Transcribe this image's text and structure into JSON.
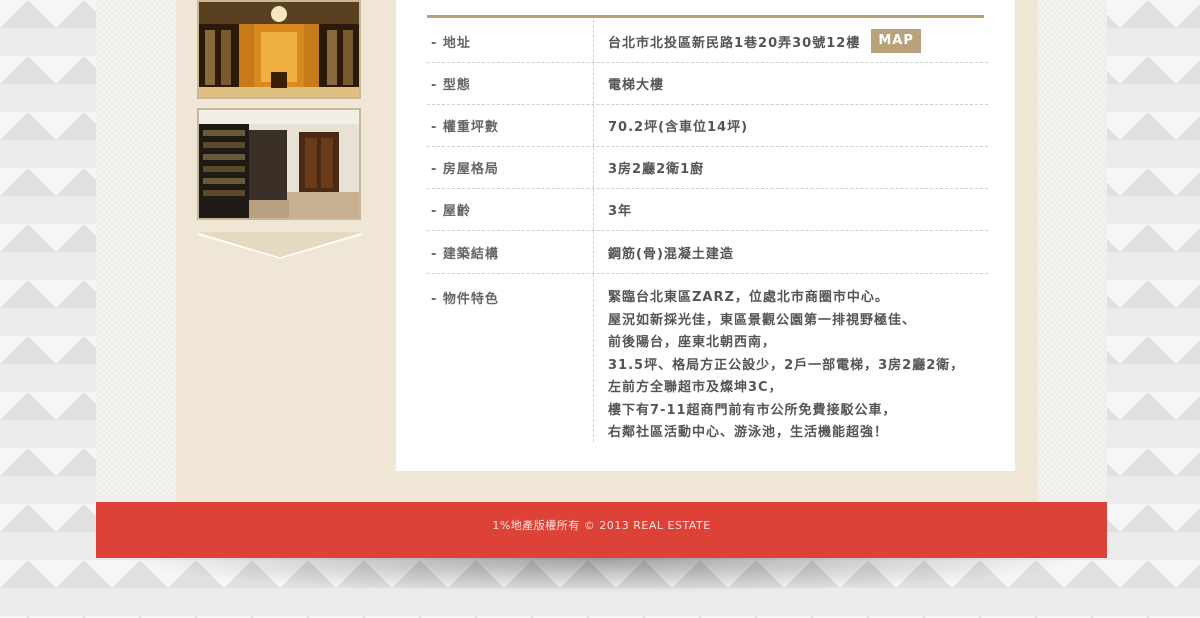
{
  "property": {
    "rows": [
      {
        "label": "- 地址",
        "value": "台北市北投區新民路1巷20弄30號12樓",
        "badge": "MAP"
      },
      {
        "label": "- 型態",
        "value": "電梯大樓"
      },
      {
        "label": "- 權重坪數",
        "value": "70.2坪(含車位14坪)"
      },
      {
        "label": "- 房屋格局",
        "value": "3房2廳2衛1廚"
      },
      {
        "label": "- 屋齡",
        "value": "3年"
      },
      {
        "label": "- 建築結構",
        "value": " 鋼筋(骨)混凝土建造"
      },
      {
        "label": "- 物件特色",
        "lines": [
          "緊臨台北東區ZARZ，位處北市商圈市中心。",
          "屋況如新採光佳，東區景觀公園第一排視野極佳、",
          "前後陽台，座東北朝西南，",
          "31.5坪、格局方正公設少，2戶一部電梯，3房2廳2衛，",
          "左前方全聯超市及燦坤3C，",
          "樓下有7-11超商門前有市公所免費接駁公車，",
          "右鄰社區活動中心、游泳池，生活機能超強！"
        ]
      }
    ]
  },
  "footer": {
    "copyright": "1%地產版權所有 © 2013 REAL ESTATE"
  },
  "colors": {
    "footer": "#dc4237",
    "accent": "#b9a17b",
    "panel": "#efe6d6"
  }
}
